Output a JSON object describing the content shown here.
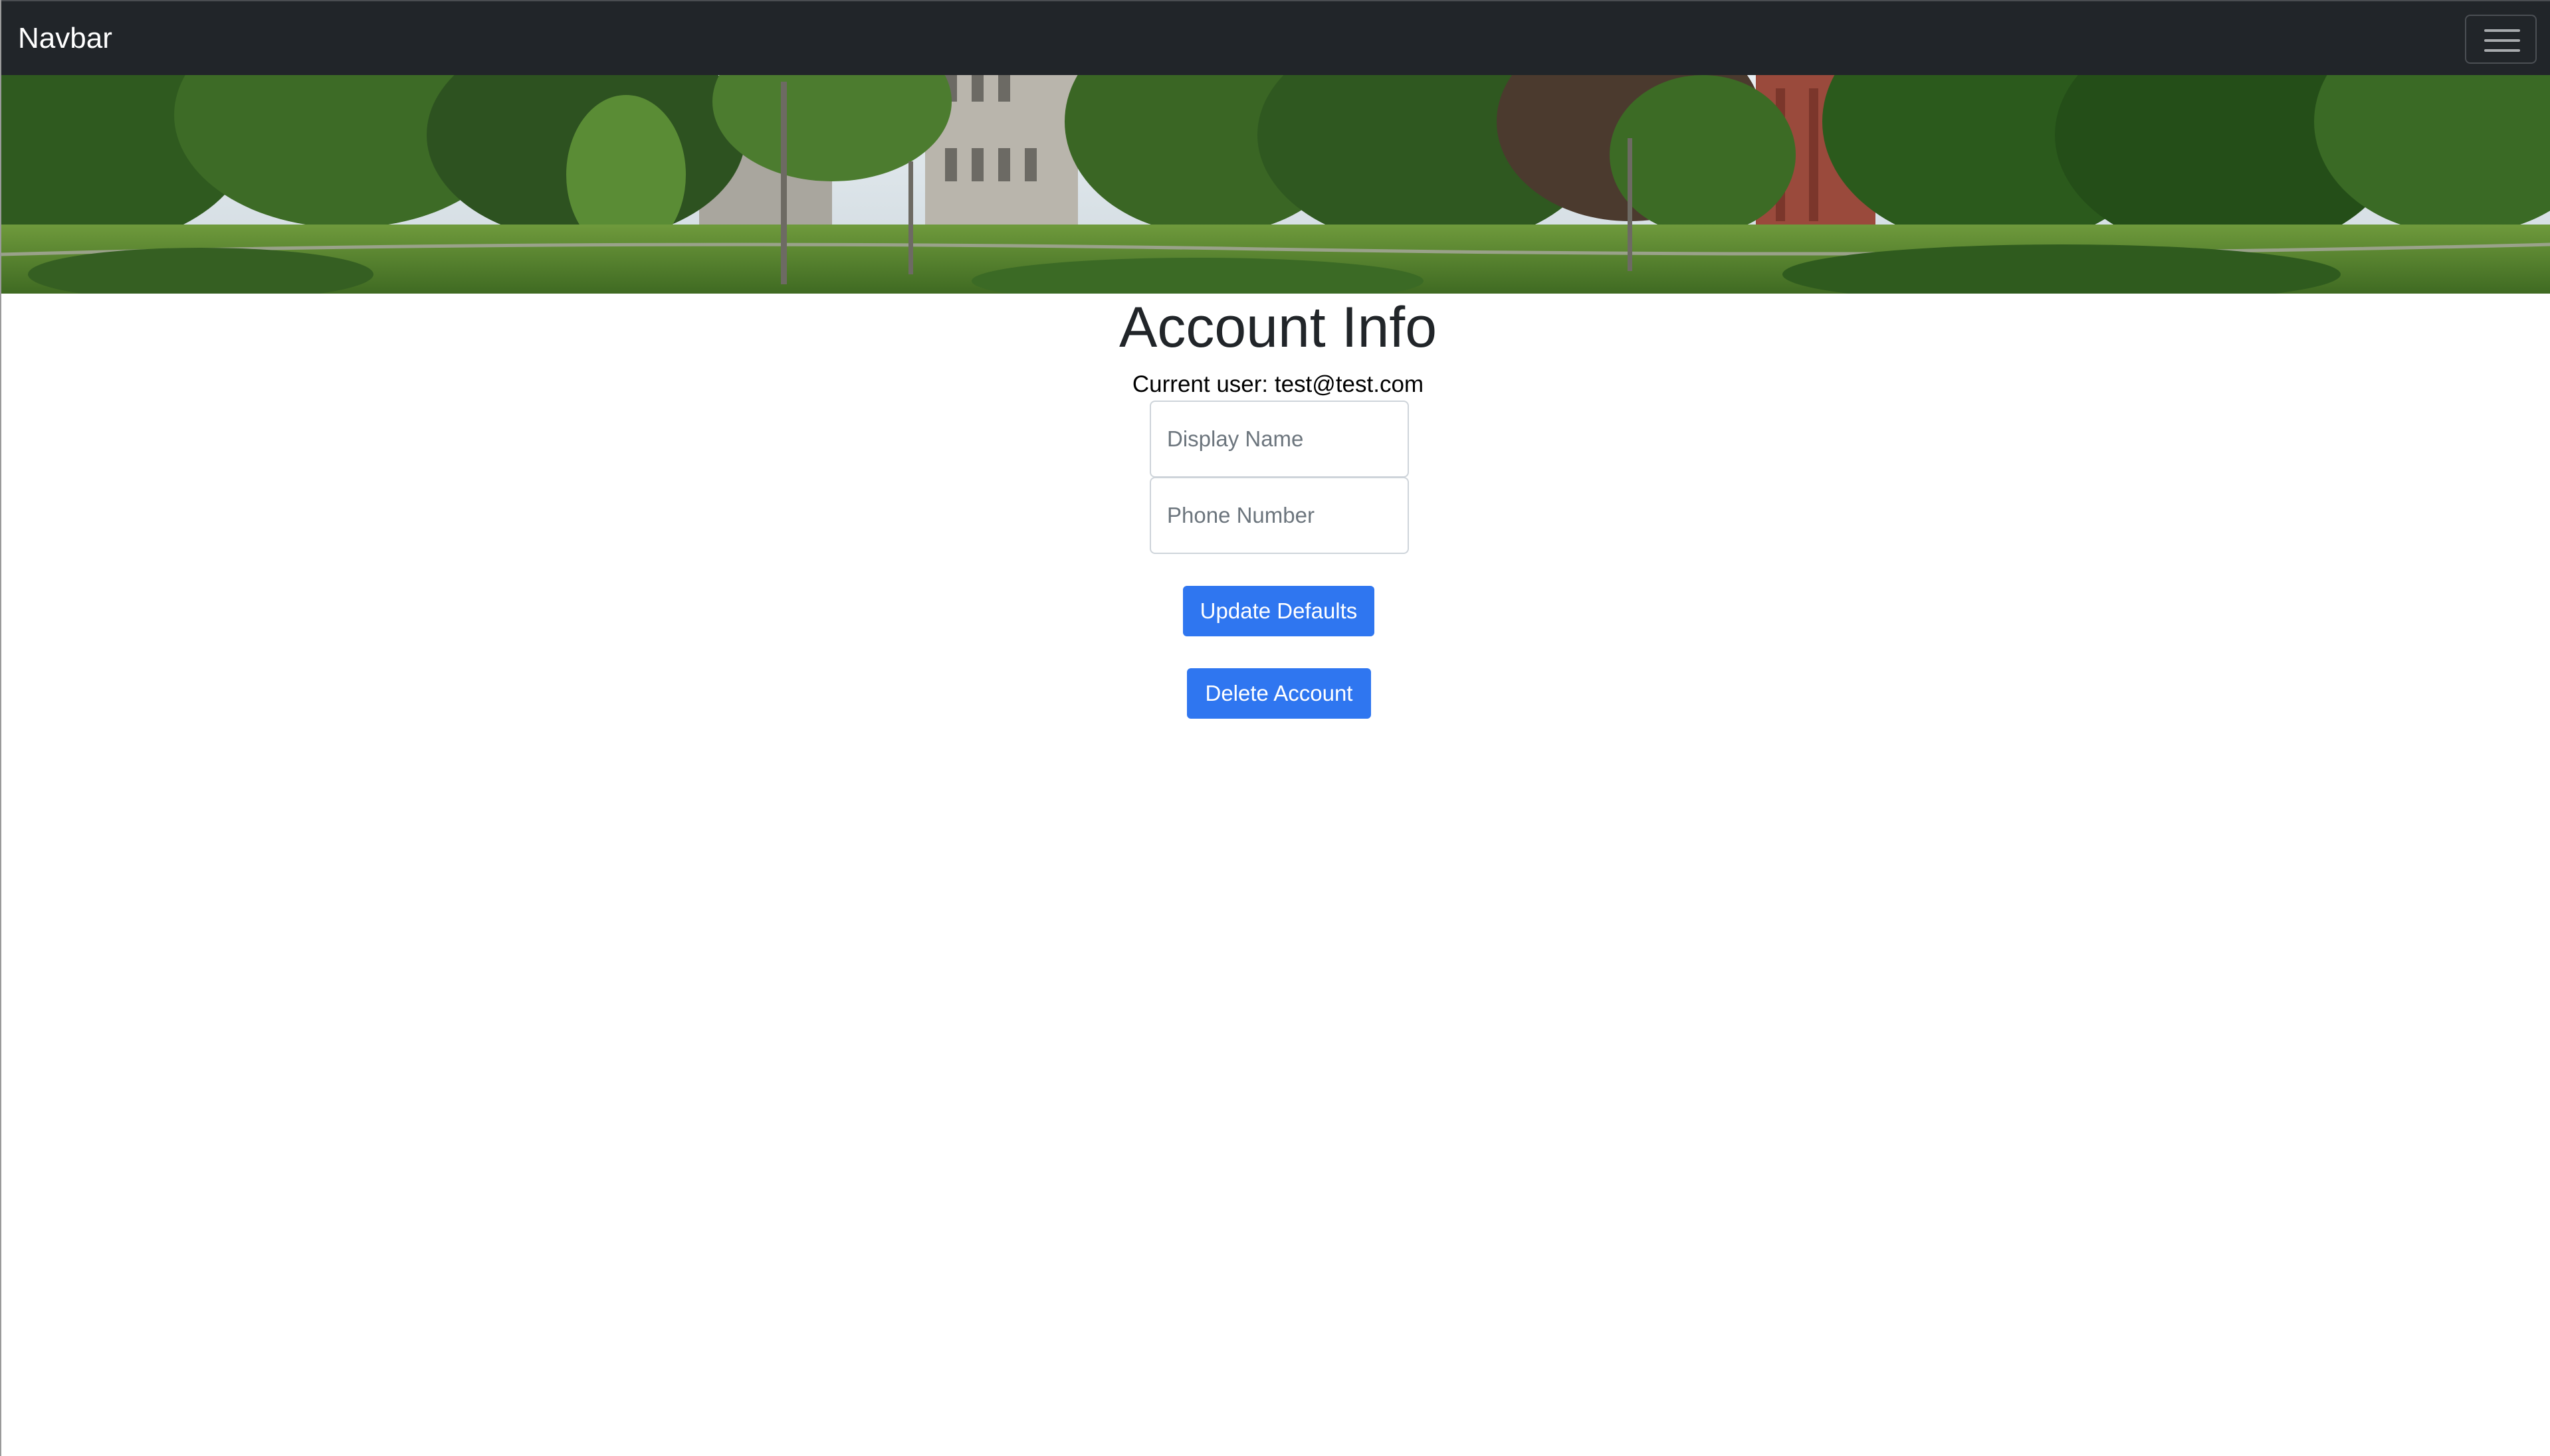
{
  "navbar": {
    "brand": "Navbar",
    "toggler_icon": "hamburger-menu-icon",
    "background": "#212529"
  },
  "banner": {
    "image": "campus-panorama-photo"
  },
  "main": {
    "title": "Account Info",
    "current_user_label": "Current user: test@test.com",
    "display_name": {
      "value": "",
      "placeholder": "Display Name"
    },
    "phone_number": {
      "value": "",
      "placeholder": "Phone Number"
    },
    "update_button": "Update Defaults",
    "delete_button": "Delete Account",
    "accent": "#2f76f0"
  }
}
